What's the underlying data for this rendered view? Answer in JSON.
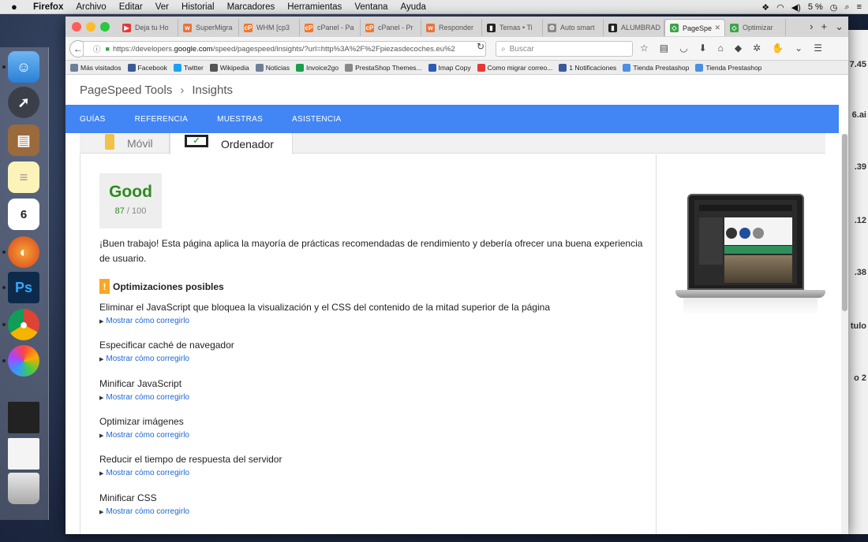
{
  "menubar": {
    "app": "Firefox",
    "items": [
      "Archivo",
      "Editar",
      "Ver",
      "Historial",
      "Marcadores",
      "Herramientas",
      "Ventana",
      "Ayuda"
    ],
    "battery": "5 %"
  },
  "browser": {
    "tabs": [
      {
        "label": "Deja tu Ho",
        "color": "#e53935",
        "glyph": "▶"
      },
      {
        "label": "SuperMigra",
        "color": "#e8733a",
        "glyph": "w"
      },
      {
        "label": "WHM [cp3",
        "color": "#f0782f",
        "glyph": "cP"
      },
      {
        "label": "cPanel - Pa",
        "color": "#f0782f",
        "glyph": "cP"
      },
      {
        "label": "cPanel - Pr",
        "color": "#f0782f",
        "glyph": "cP"
      },
      {
        "label": "Responder",
        "color": "#e8733a",
        "glyph": "w"
      },
      {
        "label": "Temas • Ti",
        "color": "#222222",
        "glyph": "▮"
      },
      {
        "label": "Auto smart",
        "color": "#888888",
        "glyph": "⚙"
      },
      {
        "label": "ALUMBRAD",
        "color": "#222222",
        "glyph": "▮"
      },
      {
        "label": "PageSpe",
        "color": "#3ca34a",
        "glyph": "◇",
        "active": true
      },
      {
        "label": "Optimizar",
        "color": "#3ca34a",
        "glyph": "◇"
      }
    ],
    "url_prefix": "https://developers.",
    "url_domain": "google.com",
    "url_rest": "/speed/pagespeed/insights/?url=http%3A%2F%2Fpiezasdecoches.eu%2",
    "search_placeholder": "Buscar",
    "bookmarks": [
      {
        "label": "Más visitados",
        "color": "#6d7f99"
      },
      {
        "label": "Facebook",
        "color": "#3b5998"
      },
      {
        "label": "Twitter",
        "color": "#1da1f2"
      },
      {
        "label": "Wikipedia",
        "color": "#555555"
      },
      {
        "label": "Noticias",
        "color": "#6d7f99"
      },
      {
        "label": "Invoice2go",
        "color": "#1b9e4b"
      },
      {
        "label": "PrestaShop Themes...",
        "color": "#888888"
      },
      {
        "label": "Imap Copy",
        "color": "#2c5bb4"
      },
      {
        "label": "Como migrar correo...",
        "color": "#e53935"
      },
      {
        "label": "1 Notificaciones",
        "color": "#3b5998"
      },
      {
        "label": "Tienda Prestashop",
        "color": "#4a90e2"
      },
      {
        "label": "Tienda Prestashop",
        "color": "#4a90e2"
      }
    ]
  },
  "page": {
    "breadcrumb_root": "PageSpeed Tools",
    "breadcrumb_sep": "›",
    "breadcrumb_leaf": "Insights",
    "nav": [
      "GUÍAS",
      "REFERENCIA",
      "MUESTRAS",
      "ASISTENCIA"
    ],
    "device_tabs": {
      "mobile": "Móvil",
      "desktop": "Ordenador"
    },
    "score": {
      "label": "Good",
      "value": "87",
      "max": "/ 100",
      "color": "#2e8b1f"
    },
    "summary": "¡Buen trabajo! Esta página aplica la mayoría de prácticas recomendadas de rendimiento y debería ofrecer una buena experiencia de usuario.",
    "optimizations_heading": "Optimizaciones posibles",
    "warn_glyph": "!",
    "show_fix_label": "Mostrar cómo corregirlo",
    "rules": [
      "Eliminar el JavaScript que bloquea la visualización y el CSS del contenido de la mitad superior de la página",
      "Especificar caché de navegador",
      "Minificar JavaScript",
      "Optimizar imágenes",
      "Reducir el tiempo de respuesta del servidor",
      "Minificar CSS"
    ]
  },
  "right_window_texts": [
    "7.45",
    "6.ai",
    ".39",
    ".12",
    ".38",
    "tulo",
    "o 2"
  ]
}
